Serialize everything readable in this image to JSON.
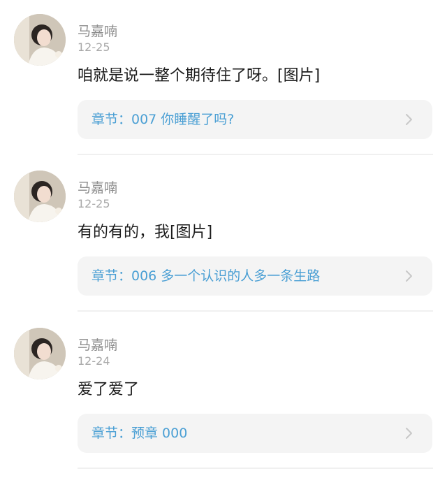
{
  "comments": [
    {
      "username": "马嘉喃",
      "date": "12-25",
      "content": "咱就是说一整个期待住了呀。[图片]",
      "chapter_label": "章节：007 你睡醒了吗?"
    },
    {
      "username": "马嘉喃",
      "date": "12-25",
      "content": "有的有的，我[图片]",
      "chapter_label": "章节：006 多一个认识的人多一条生路"
    },
    {
      "username": "马嘉喃",
      "date": "12-24",
      "content": "爱了爱了",
      "chapter_label": "章节：预章 000"
    }
  ],
  "colors": {
    "chapter_link": "#4a9fd4",
    "card_background": "#f4f4f4",
    "username": "#8d8d8d",
    "date": "#a8a8a8",
    "content": "#1c1c1c"
  },
  "icons": {
    "avatar": "user-avatar-photo",
    "chevron": "chevron-right-icon"
  }
}
